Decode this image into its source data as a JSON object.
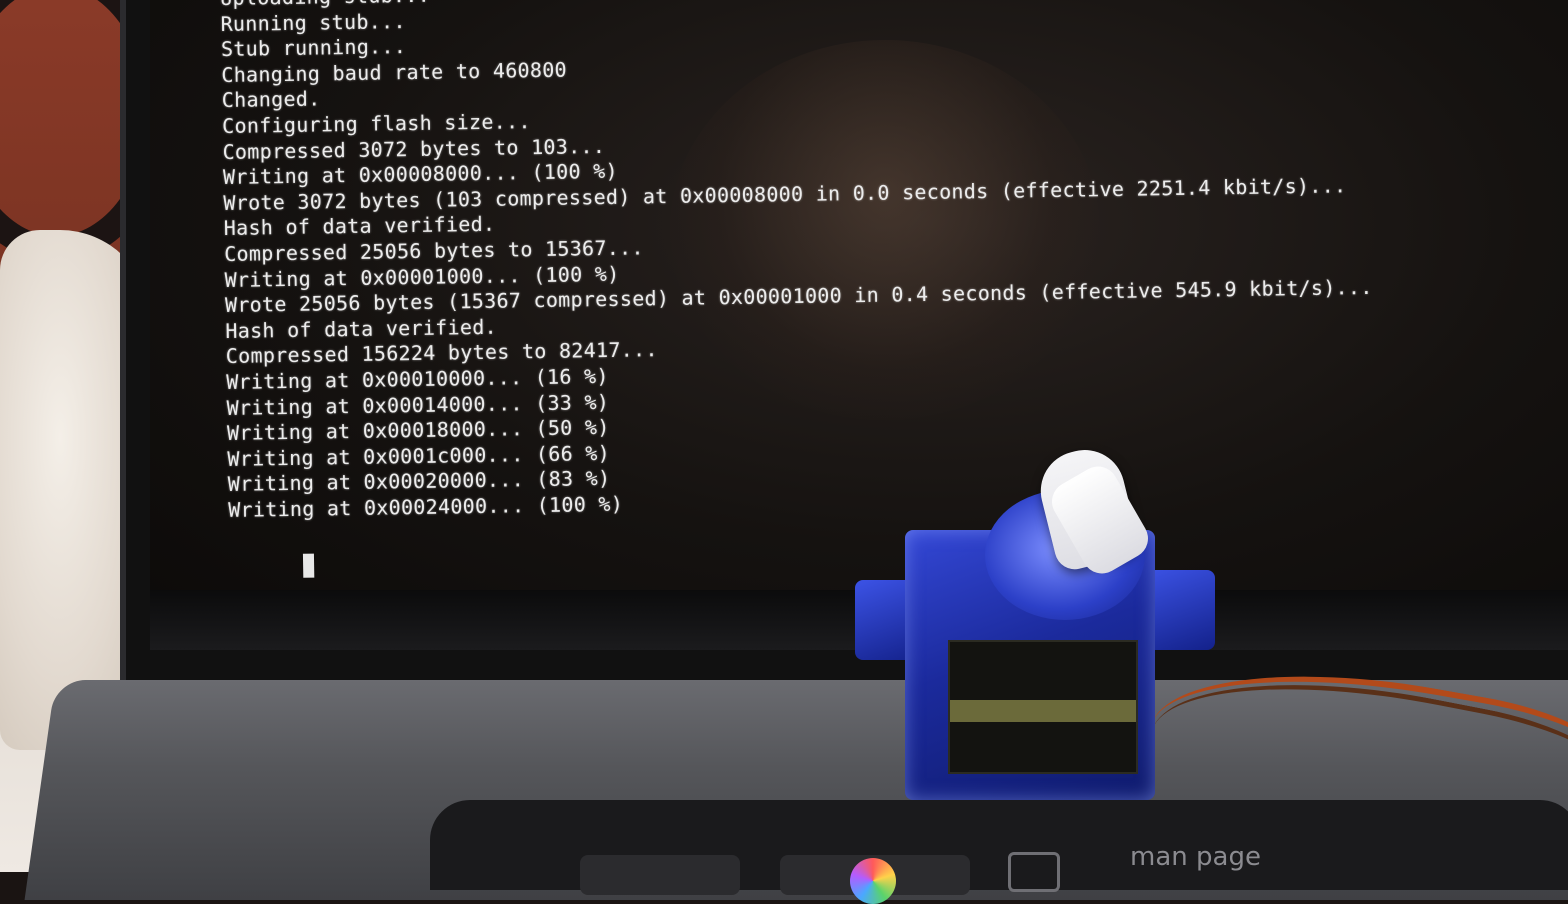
{
  "terminal": {
    "lines": [
      "Uploading stub...",
      "Running stub...",
      "Stub running...",
      "Changing baud rate to 460800",
      "Changed.",
      "Configuring flash size...",
      "Compressed 3072 bytes to 103...",
      "Writing at 0x00008000... (100 %)",
      "Wrote 3072 bytes (103 compressed) at 0x00008000 in 0.0 seconds (effective 2251.4 kbit/s)...",
      "Hash of data verified.",
      "Compressed 25056 bytes to 15367...",
      "Writing at 0x00001000... (100 %)",
      "Wrote 25056 bytes (15367 compressed) at 0x00001000 in 0.4 seconds (effective 545.9 kbit/s)...",
      "Hash of data verified.",
      "Compressed 156224 bytes to 82417...",
      "Writing at 0x00010000... (16 %)",
      "Writing at 0x00014000... (33 %)",
      "Writing at 0x00018000... (50 %)",
      "Writing at 0x0001c000... (66 %)",
      "Writing at 0x00020000... (83 %)",
      "Writing at 0x00024000... (100 %)"
    ]
  },
  "touchbar": {
    "label": "man page"
  },
  "colors": {
    "terminal_text": "#ececec",
    "terminal_bg": "#151210",
    "servo_blue": "#1b2a9c",
    "horn_white": "#f5f5f7",
    "deck_gray": "#55565a"
  },
  "icons": [
    "cursor-block",
    "color-picker-icon",
    "document-icon"
  ]
}
